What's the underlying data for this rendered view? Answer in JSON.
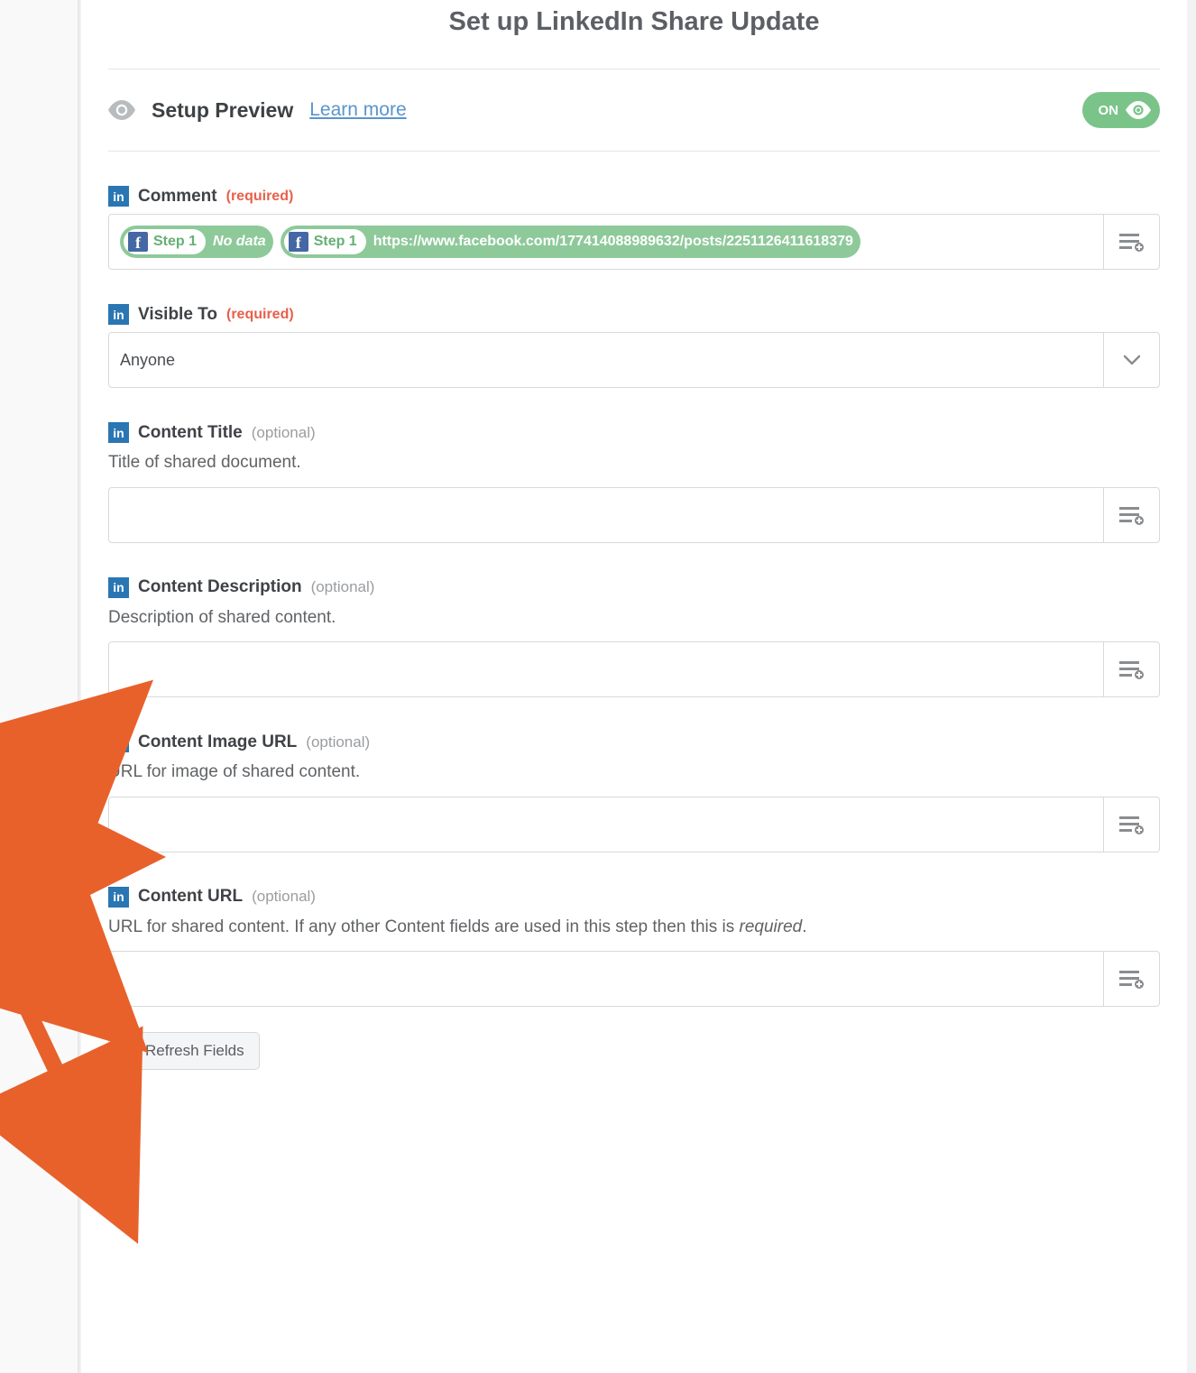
{
  "page": {
    "title": "Set up LinkedIn Share Update"
  },
  "preview": {
    "title": "Setup Preview",
    "learn_more": "Learn more"
  },
  "toggle": {
    "label": "ON"
  },
  "fields": {
    "comment": {
      "label": "Comment",
      "required_label": "(required)",
      "pills": [
        {
          "step": "Step 1",
          "text": "No data",
          "italic": true
        },
        {
          "step": "Step 1",
          "text": "https://www.facebook.com/177414088989632/posts/2251126411618379",
          "italic": false
        }
      ]
    },
    "visible_to": {
      "label": "Visible To",
      "required_label": "(required)",
      "value": "Anyone"
    },
    "content_title": {
      "label": "Content Title",
      "optional_label": "(optional)",
      "helper": "Title of shared document."
    },
    "content_description": {
      "label": "Content Description",
      "optional_label": "(optional)",
      "helper": "Description of shared content."
    },
    "content_image_url": {
      "label": "Content Image URL",
      "optional_label": "(optional)",
      "helper": "URL for image of shared content."
    },
    "content_url": {
      "label": "Content URL",
      "optional_label": "(optional)",
      "helper_pre": "URL for shared content. If any other Content fields are used in this step then this is ",
      "helper_em": "required",
      "helper_post": "."
    }
  },
  "buttons": {
    "refresh": "Refresh Fields"
  }
}
